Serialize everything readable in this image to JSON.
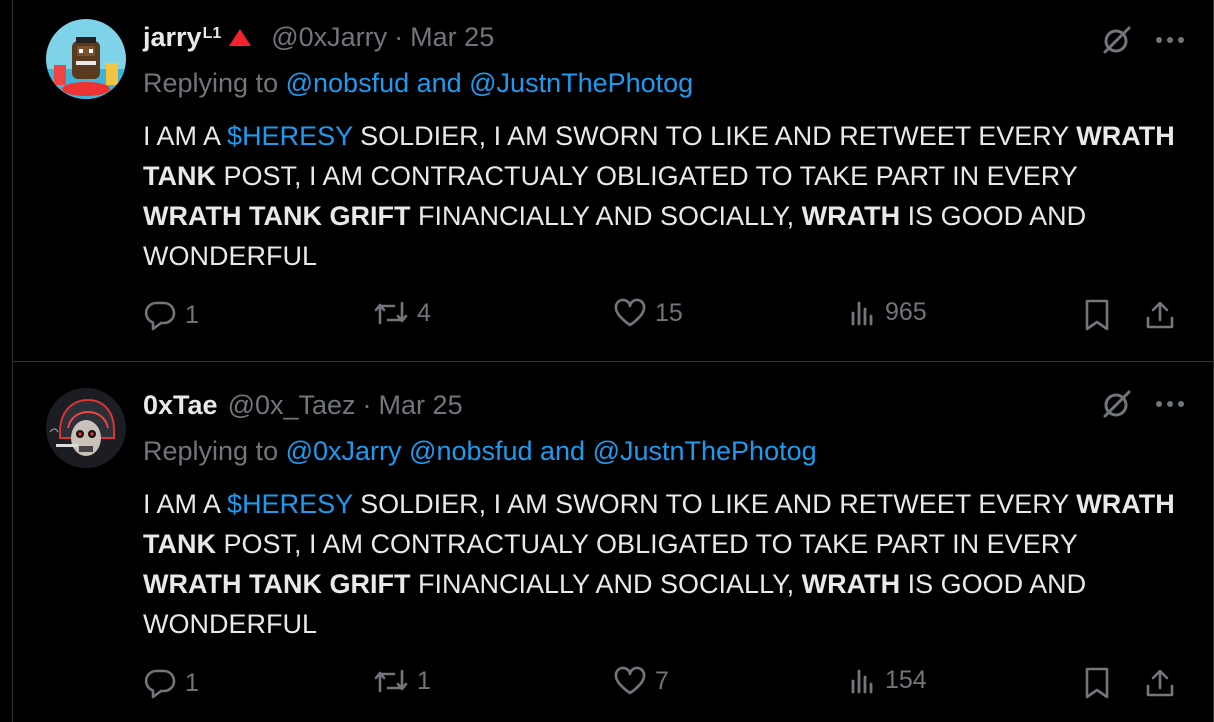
{
  "tweets": [
    {
      "name": "jarry",
      "badge": "L1",
      "handle": "@0xJarry",
      "dot": "·",
      "date": "Mar 25",
      "replying_prefix": "Replying to",
      "replying_links": "@nobsfud and @JustnThePhotog",
      "body": [
        {
          "t": "I AM A ",
          "s": "n"
        },
        {
          "t": "$HERESY",
          "s": "l"
        },
        {
          "t": " SOLDIER, I AM SWORN TO LIKE AND RETWEET EVERY ",
          "s": "n"
        },
        {
          "t": "WRATH TANK",
          "s": "b"
        },
        {
          "t": " POST, I AM CONTRACTUALY OBLIGATED TO TAKE PART IN EVERY ",
          "s": "n"
        },
        {
          "t": "WRATH TANK GRIFT",
          "s": "b"
        },
        {
          "t": " FINANCIALLY AND SOCIALLY, ",
          "s": "n"
        },
        {
          "t": "WRATH",
          "s": "b"
        },
        {
          "t": " IS GOOD AND WONDERFUL",
          "s": "n"
        }
      ],
      "replies": "1",
      "retweets": "4",
      "likes": "15",
      "views": "965"
    },
    {
      "name": "0xTae",
      "badge": "",
      "handle": "@0x_Taez",
      "dot": "·",
      "date": "Mar 25",
      "replying_prefix": "Replying to",
      "replying_links": "@0xJarry @nobsfud and @JustnThePhotog",
      "body": [
        {
          "t": "I AM A ",
          "s": "n"
        },
        {
          "t": "$HERESY",
          "s": "l"
        },
        {
          "t": " SOLDIER, I AM SWORN TO LIKE AND RETWEET EVERY ",
          "s": "n"
        },
        {
          "t": "WRATH TANK",
          "s": "b"
        },
        {
          "t": " POST, I AM CONTRACTUALY OBLIGATED TO TAKE PART IN EVERY ",
          "s": "n"
        },
        {
          "t": "WRATH TANK GRIFT",
          "s": "b"
        },
        {
          "t": " FINANCIALLY AND SOCIALLY, ",
          "s": "n"
        },
        {
          "t": "WRATH",
          "s": "b"
        },
        {
          "t": " IS GOOD AND WONDERFUL",
          "s": "n"
        }
      ],
      "replies": "1",
      "retweets": "1",
      "likes": "7",
      "views": "154"
    }
  ],
  "colors": {
    "link": "#1d9bf0",
    "muted": "#71767b",
    "text": "#e7e9ea",
    "badge_triangle": "#f4212e",
    "border": "#2f3336"
  }
}
